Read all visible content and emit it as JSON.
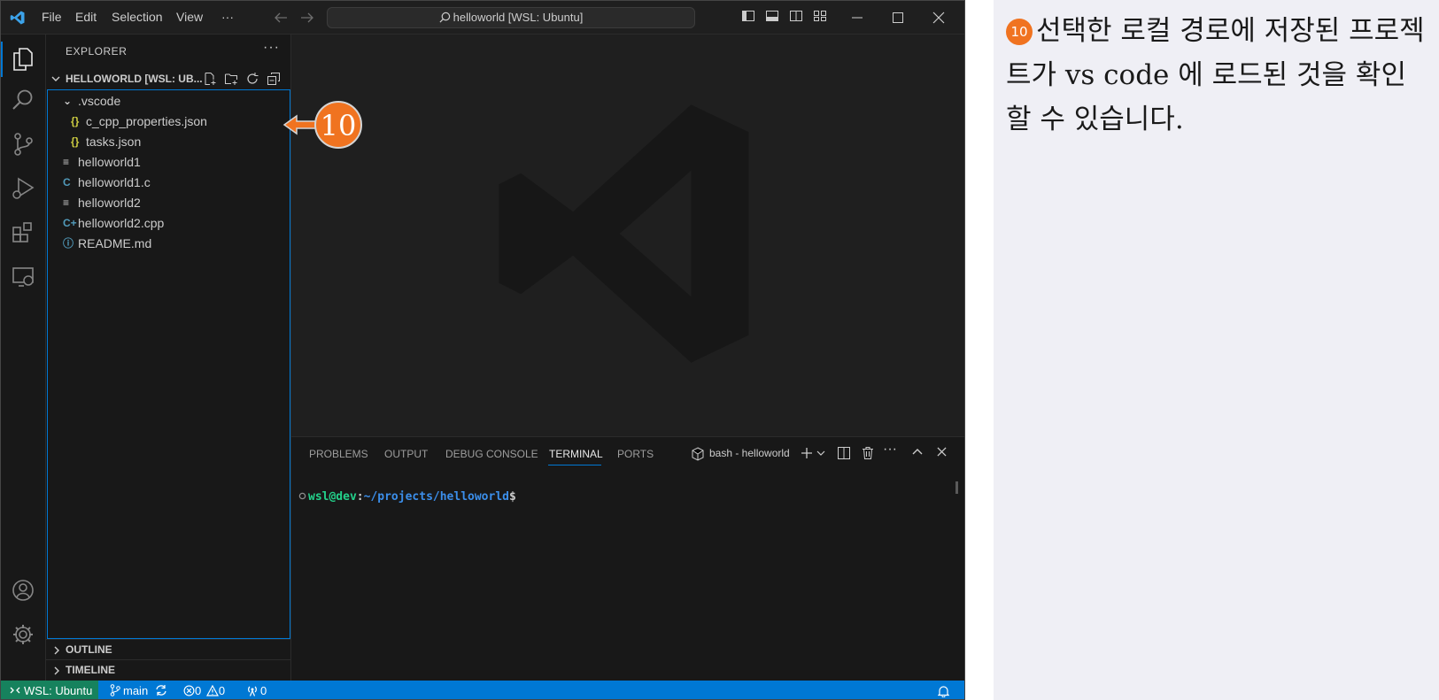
{
  "titlebar": {
    "menu": [
      "File",
      "Edit",
      "Selection",
      "View"
    ],
    "more": "···",
    "search_text": "helloworld [WSL: Ubuntu]"
  },
  "sidebar": {
    "title": "EXPLORER",
    "more": "···",
    "folder_name": "HELLOWORLD [WSL: UB...",
    "tree": [
      {
        "label": ".vscode",
        "icon": "chevron-down-icon",
        "glyph": "⌄",
        "indent": 1,
        "color": "#cccccc"
      },
      {
        "label": "c_cpp_properties.json",
        "icon": "json-file-icon",
        "glyph": "{}",
        "indent": 2,
        "color": "#cbcb41"
      },
      {
        "label": "tasks.json",
        "icon": "json-file-icon",
        "glyph": "{}",
        "indent": 2,
        "color": "#cbcb41"
      },
      {
        "label": "helloworld1",
        "icon": "text-file-icon",
        "glyph": "≡",
        "indent": 1,
        "color": "#cccccc"
      },
      {
        "label": "helloworld1.c",
        "icon": "c-file-icon",
        "glyph": "C",
        "indent": 1,
        "color": "#519aba"
      },
      {
        "label": "helloworld2",
        "icon": "text-file-icon",
        "glyph": "≡",
        "indent": 1,
        "color": "#cccccc"
      },
      {
        "label": "helloworld2.cpp",
        "icon": "cpp-file-icon",
        "glyph": "C+",
        "indent": 1,
        "color": "#519aba"
      },
      {
        "label": "README.md",
        "icon": "info-icon",
        "glyph": "ⓘ",
        "indent": 1,
        "color": "#519aba"
      }
    ],
    "outline": "OUTLINE",
    "timeline": "TIMELINE"
  },
  "panel": {
    "tabs": [
      "PROBLEMS",
      "OUTPUT",
      "DEBUG CONSOLE",
      "TERMINAL",
      "PORTS"
    ],
    "active_tab": "TERMINAL",
    "terminal_name": "bash - helloworld",
    "prompt_user": "wsl@dev",
    "prompt_sep": ":",
    "prompt_path": "~/projects/helloworld",
    "prompt_symbol": "$"
  },
  "statusbar": {
    "remote": "WSL: Ubuntu",
    "branch": "main",
    "errors": "0",
    "warnings": "0",
    "ports": "0"
  },
  "callout": {
    "number": "10"
  },
  "explanation": {
    "badge": "10",
    "text": "선택한 로컬 경로에 저장된 프로젝트가  vs code 에 로드된 것을 확인 할 수 있습니다."
  },
  "colors": {
    "accent": "#0078d4",
    "remote_bg": "#16825d",
    "callout": "#f07320",
    "prompt_user": "#23d18b",
    "prompt_path": "#3b8eea"
  }
}
